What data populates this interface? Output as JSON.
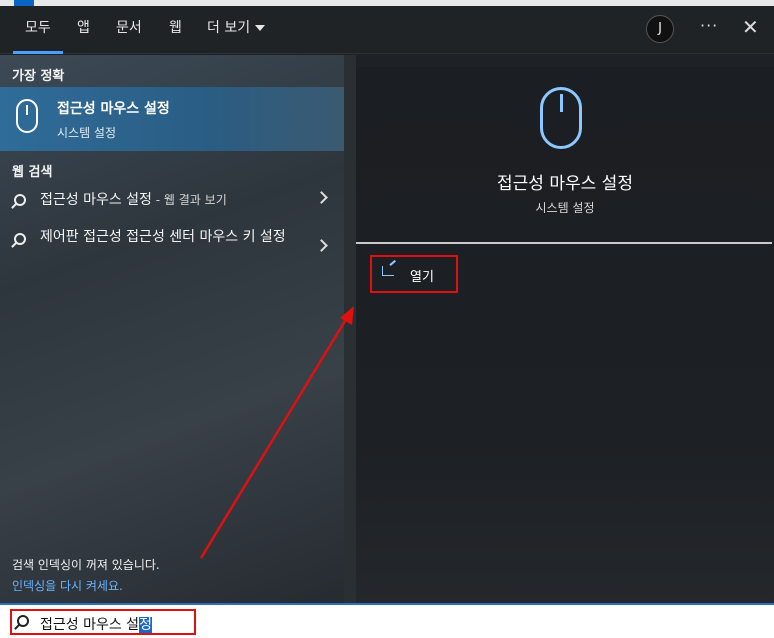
{
  "tabs": [
    {
      "label": "모두",
      "active": true
    },
    {
      "label": "앱"
    },
    {
      "label": "문서"
    },
    {
      "label": "웹"
    },
    {
      "label": "더 보기"
    }
  ],
  "header": {
    "avatar_initial": "J",
    "more_label": "···",
    "close_label": "✕"
  },
  "left": {
    "best_match_label": "가장 정확",
    "best_match": {
      "title": "접근성 마우스 설정",
      "subtitle": "시스템 설정",
      "icon": "mouse-icon"
    },
    "web_label": "웹 검색",
    "web_results": [
      {
        "text": "접근성 마우스 설정",
        "suffix": " - 웹 결과 보기"
      },
      {
        "text": "제어판 접근성 접근성 센터 마우스 키 설정"
      }
    ],
    "index_notice": "검색 인덱싱이 꺼져 있습니다.",
    "index_link": "인덱싱을 다시 켜세요."
  },
  "detail": {
    "title": "접근성 마우스 설정",
    "subtitle": "시스템 설정",
    "open_label": "열기",
    "icon": "mouse-icon",
    "open_icon": "open-icon"
  },
  "search": {
    "query_prefix": "접근성 마우스 설",
    "query_selected": "정"
  },
  "colors": {
    "accent": "#4aa0ff",
    "highlight": "#e01010",
    "selection": "#1967c8"
  }
}
